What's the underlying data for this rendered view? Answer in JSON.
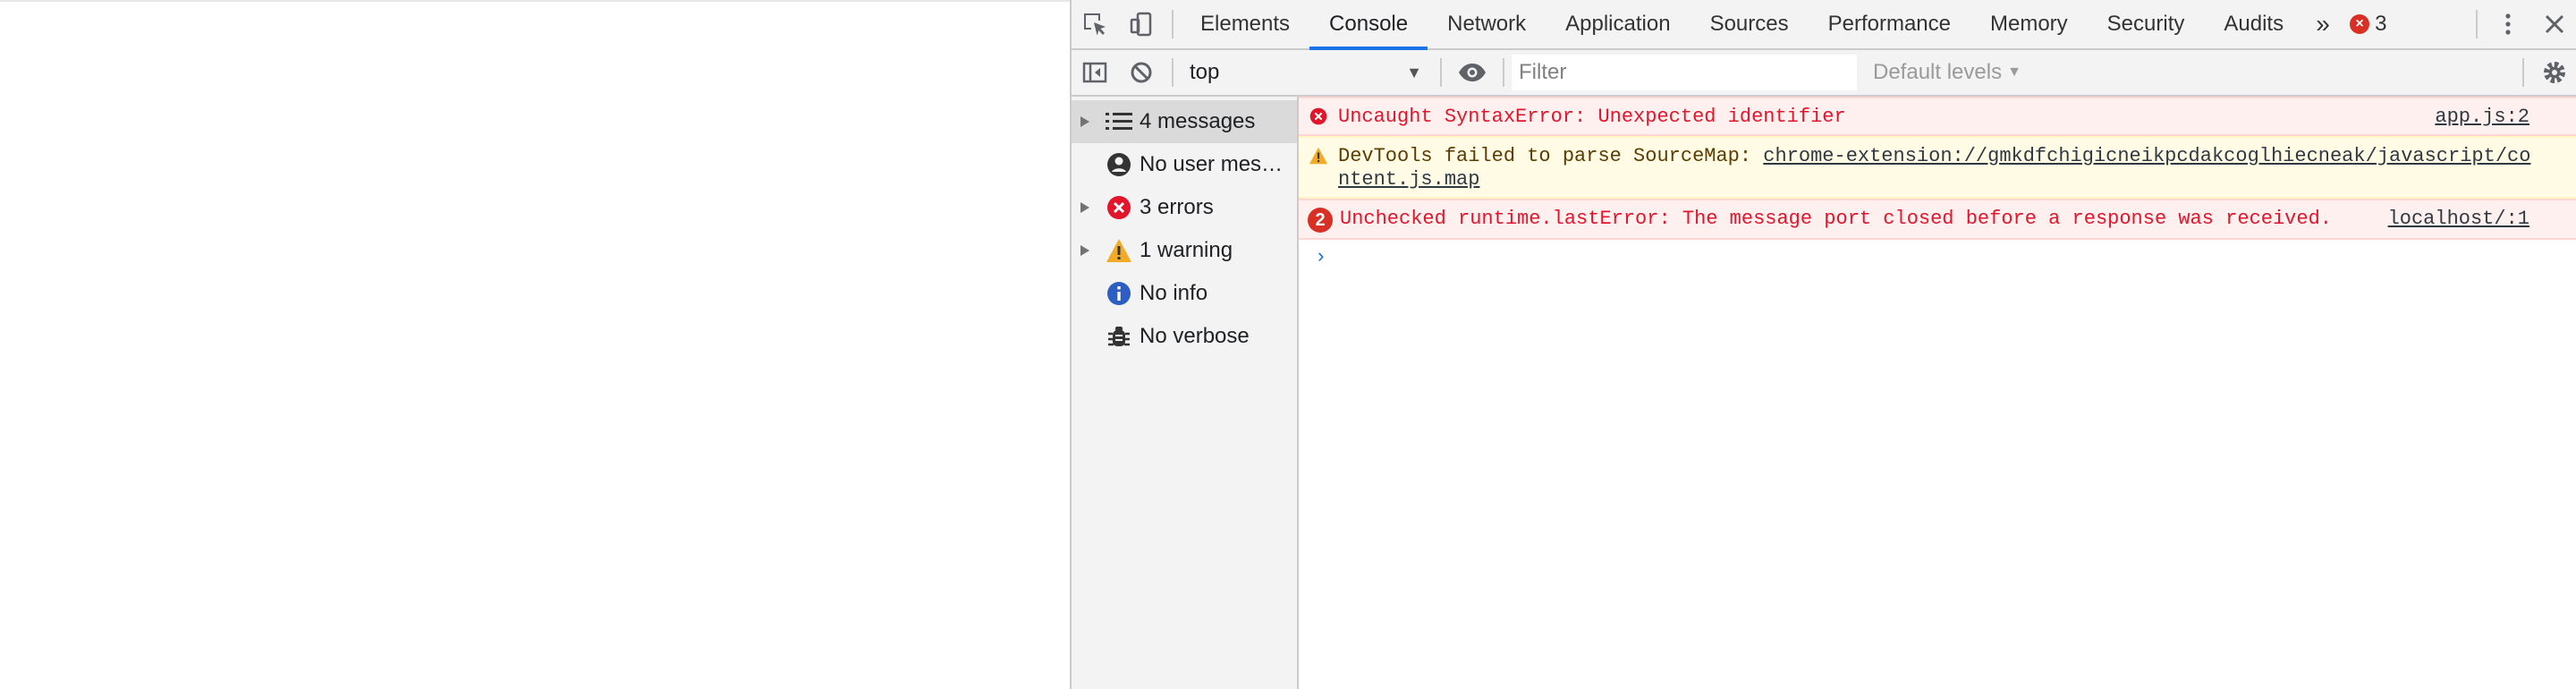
{
  "tabs": [
    {
      "label": "Elements"
    },
    {
      "label": "Console"
    },
    {
      "label": "Network"
    },
    {
      "label": "Application"
    },
    {
      "label": "Sources"
    },
    {
      "label": "Performance"
    },
    {
      "label": "Memory"
    },
    {
      "label": "Security"
    },
    {
      "label": "Audits"
    }
  ],
  "tabbar": {
    "more": "»",
    "error_count": "3"
  },
  "toolbar": {
    "context": "top",
    "filter_placeholder": "Filter",
    "levels": "Default levels"
  },
  "sidebar": {
    "items": [
      {
        "label": "4 messages"
      },
      {
        "label": "No user messages"
      },
      {
        "label": "3 errors"
      },
      {
        "label": "1 warning"
      },
      {
        "label": "No info"
      },
      {
        "label": "No verbose"
      }
    ]
  },
  "messages": [
    {
      "level": "error",
      "text": "Uncaught SyntaxError: Unexpected identifier",
      "source": "app.js:2"
    },
    {
      "level": "warning",
      "text": "DevTools failed to parse SourceMap: ",
      "link": "chrome-extension://gmkdfchigicneikpcdakcoglhiecneak/javascript/content.js.map"
    },
    {
      "level": "error",
      "repeat": "2",
      "text": "Unchecked runtime.lastError: The message port closed before a response was received.",
      "source": "localhost/:1"
    }
  ],
  "prompt": "›",
  "colors": {
    "accent": "#1a73e8",
    "error": "#e2152b",
    "warning": "#f2ab26",
    "info": "#2c5ec4"
  }
}
